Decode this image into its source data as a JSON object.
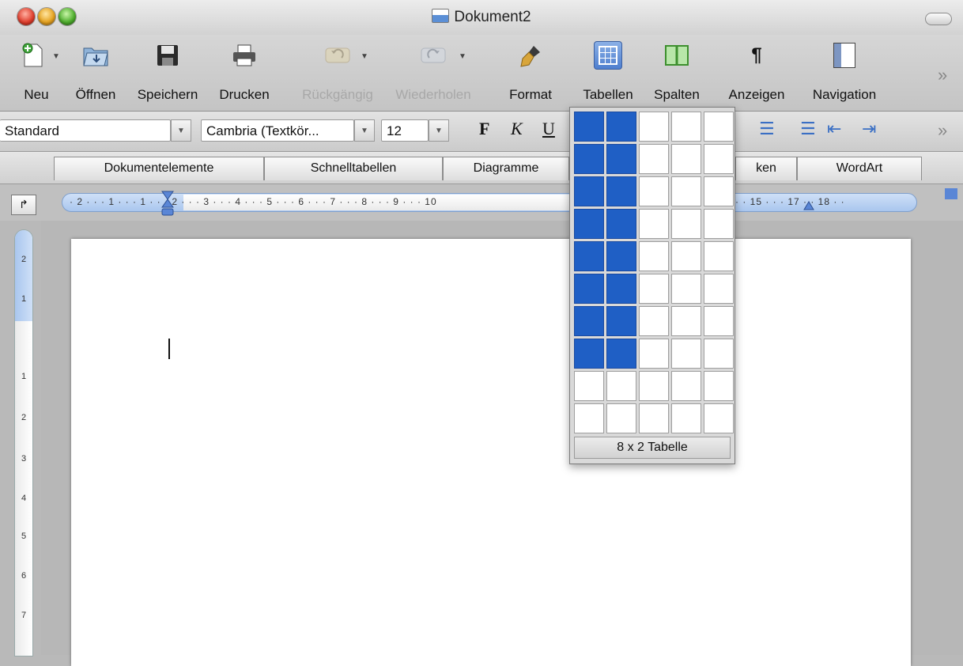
{
  "window": {
    "title": "Dokument2"
  },
  "toolbar": {
    "items": [
      {
        "label": "Neu",
        "icon": "new-document-icon"
      },
      {
        "label": "Öffnen",
        "icon": "open-folder-icon"
      },
      {
        "label": "Speichern",
        "icon": "save-disk-icon"
      },
      {
        "label": "Drucken",
        "icon": "printer-icon"
      },
      {
        "label": "Rückgängig",
        "icon": "undo-icon",
        "disabled": true
      },
      {
        "label": "Wiederholen",
        "icon": "redo-icon",
        "disabled": true
      },
      {
        "label": "Format",
        "icon": "format-brush-icon"
      },
      {
        "label": "Tabellen",
        "icon": "table-icon",
        "active": true
      },
      {
        "label": "Spalten",
        "icon": "columns-icon"
      },
      {
        "label": "Anzeigen",
        "icon": "pilcrow-icon"
      },
      {
        "label": "Navigation",
        "icon": "navigation-pane-icon"
      }
    ]
  },
  "formatbar": {
    "style": "Standard",
    "font": "Cambria (Textkör...",
    "size": "12",
    "bold": "F",
    "italic": "K",
    "underline": "U"
  },
  "ribbon_tabs": [
    "Dokumentelemente",
    "Schnelltabellen",
    "Diagramme",
    "ken",
    "WordArt"
  ],
  "ruler": {
    "numbers": "· 2 · · · 1 · · · 1 · · · 2 · · · 3 · · · 4 · · · 5 · · · 6 · · · 7 · · · 8 · · · 9 · · · 10",
    "numbers_right": "· · 15 · · · 17 · · 18 · ·",
    "tab_selector": "↱"
  },
  "vertical_ruler": [
    "2",
    "1",
    "1",
    "2",
    "3",
    "4",
    "5",
    "6",
    "7"
  ],
  "table_picker": {
    "rows": 10,
    "cols": 5,
    "selected_rows": 8,
    "selected_cols": 2,
    "label": "8 x 2 Tabelle"
  },
  "colors": {
    "selection": "#1f5fc5",
    "ruler_blue": "#a9c6ee"
  }
}
